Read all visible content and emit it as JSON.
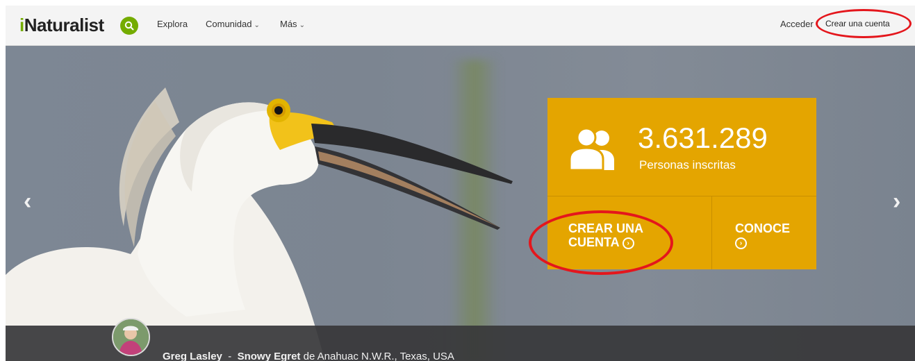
{
  "header": {
    "logo_prefix": "i",
    "logo_rest": "Naturalist",
    "nav": [
      {
        "label": "Explora"
      },
      {
        "label": "Comunidad",
        "chevron": "⌄"
      },
      {
        "label": "Más",
        "chevron": "⌄"
      }
    ],
    "login_label": "Acceder",
    "signup_label": "Crear una cuenta"
  },
  "hero": {
    "prev_icon": "‹",
    "next_icon": "›",
    "stats": {
      "count": "3.631.289",
      "label": "Personas inscritas"
    },
    "cta_create_line1": "CREAR UNA",
    "cta_create_line2": "CUENTA",
    "cta_learn": "CONOCE",
    "arrow_icon": "›"
  },
  "caption": {
    "author": "Greg Lasley",
    "separator": "-",
    "species": "Snowy Egret",
    "location": "de Anahuac N.W.R., Texas, USA"
  },
  "colors": {
    "brand_green": "#74ac00",
    "panel_yellow": "#e4a500",
    "annotation_red": "#e4161c"
  }
}
